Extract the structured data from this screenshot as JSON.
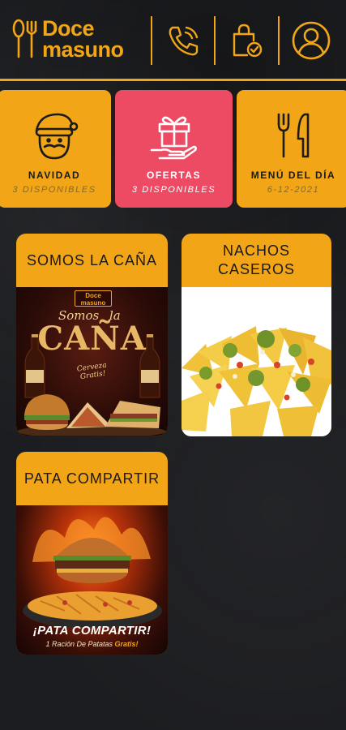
{
  "brand": {
    "line1": "Doce",
    "line2": "masuno"
  },
  "header": {
    "icons": [
      "phone-icon",
      "shopping-bag-check-icon",
      "user-account-icon"
    ]
  },
  "categories": [
    {
      "title": "NAVIDAD",
      "subtitle": "3 DISPONIBLES",
      "icon": "santa-icon",
      "active": false
    },
    {
      "title": "OFERTAS",
      "subtitle": "3 DISPONIBLES",
      "icon": "gift-hand-icon",
      "active": true
    },
    {
      "title": "MENÚ DEL DÍA",
      "subtitle": "6-12-2021",
      "icon": "fork-knife-icon",
      "active": false
    }
  ],
  "promos": [
    {
      "title": "SOMOS LA CAÑA",
      "poster": {
        "brand_top": "Doce",
        "brand_bottom": "masuno",
        "script_left": "Somos",
        "script_right": "la",
        "headline": "CAÑA",
        "tagline_1": "Cerveza",
        "tagline_2": "Gratis!"
      }
    },
    {
      "title": "NACHOS CASEROS"
    },
    {
      "title": "PATA COMPARTIR",
      "poster": {
        "headline": "¡PATA COMPARTIR!",
        "subline": "1 Ración De Patatas",
        "subline_accent": "Gratis!"
      }
    }
  ],
  "colors": {
    "accent": "#f2a516",
    "active": "#ec4b63",
    "background": "#1c1d20"
  }
}
